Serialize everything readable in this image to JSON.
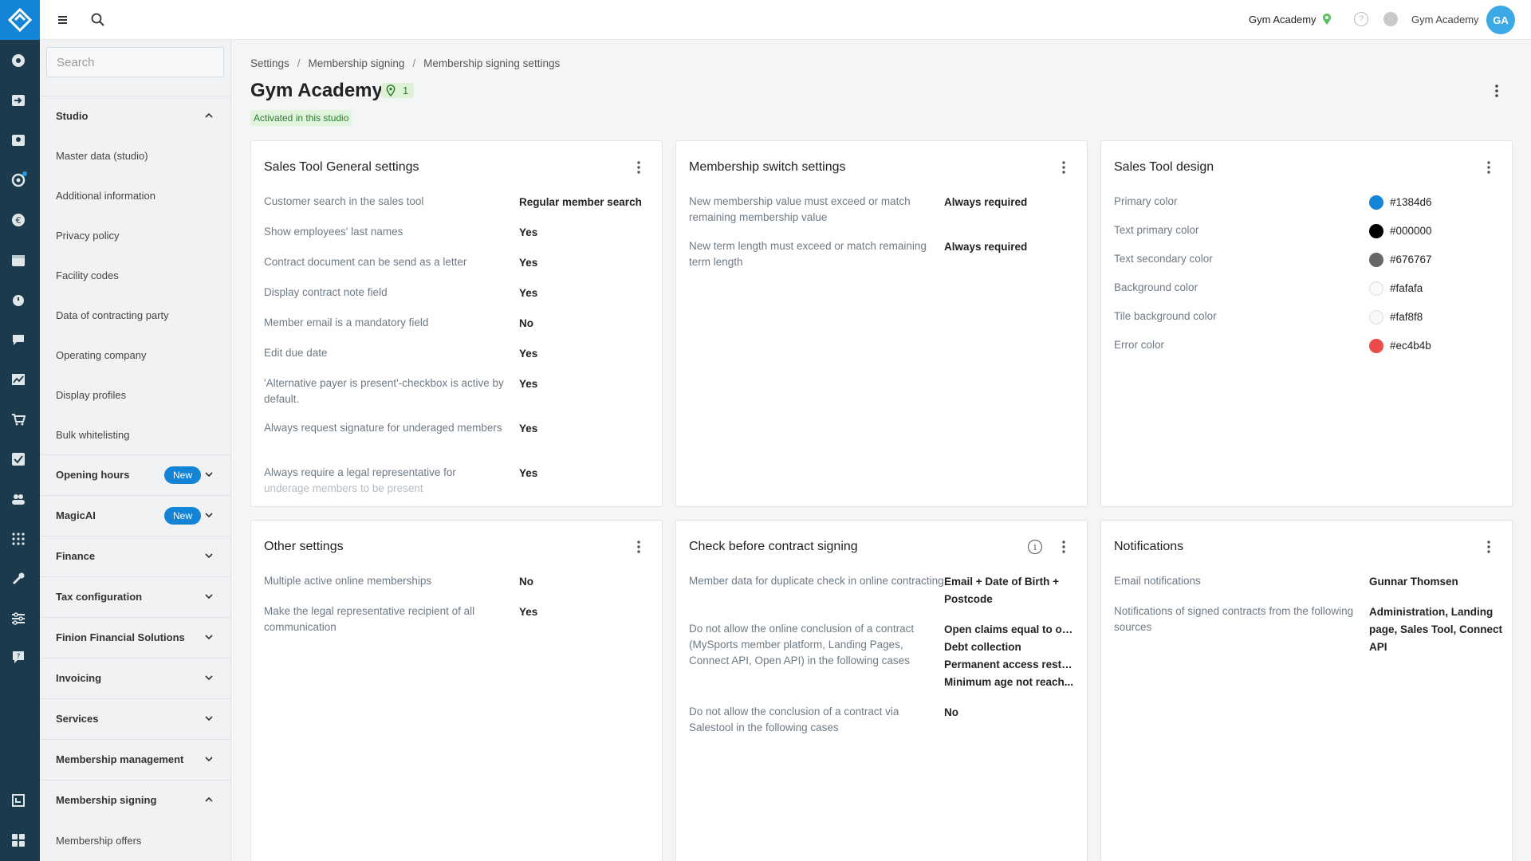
{
  "topbar": {
    "studio_name": "Gym Academy",
    "user_name": "Gym Academy",
    "avatar_initials": "GA",
    "help_glyph": "?"
  },
  "sidebar": {
    "search_placeholder": "Search",
    "sections": [
      {
        "label": "Studio",
        "expanded": true
      },
      {
        "label": "Opening hours",
        "badge": "New",
        "expanded": false
      },
      {
        "label": "MagicAI",
        "badge": "New",
        "expanded": false
      },
      {
        "label": "Finance",
        "expanded": false
      },
      {
        "label": "Tax configuration",
        "expanded": false
      },
      {
        "label": "Finion Financial Solutions",
        "expanded": false
      },
      {
        "label": "Invoicing",
        "expanded": false
      },
      {
        "label": "Services",
        "expanded": false
      },
      {
        "label": "Membership management",
        "expanded": false
      },
      {
        "label": "Membership signing",
        "expanded": true
      }
    ],
    "studio_items": [
      "Master data (studio)",
      "Additional information",
      "Privacy policy",
      "Facility codes",
      "Data of contracting party",
      "Operating company",
      "Display profiles",
      "Bulk whitelisting"
    ],
    "signing_items": [
      "Membership offers"
    ]
  },
  "breadcrumb": [
    "Settings",
    "Membership signing",
    "Membership signing settings"
  ],
  "breadcrumb_sep": "/",
  "page": {
    "title": "Gym Academy",
    "location_count": "1",
    "activated_label": "Activated in this studio"
  },
  "cards": {
    "general": {
      "title": "Sales Tool General settings",
      "rows": [
        {
          "label": "Customer search in the sales tool",
          "value": "Regular member search"
        },
        {
          "label": "Show employees' last names",
          "value": "Yes"
        },
        {
          "label": "Contract document can be send as a letter",
          "value": "Yes"
        },
        {
          "label": "Display contract note field",
          "value": "Yes"
        },
        {
          "label": "Member email is a mandatory field",
          "value": "No"
        },
        {
          "label": "Edit due date",
          "value": "Yes"
        },
        {
          "label": "'Alternative payer is present'-checkbox is active by default.",
          "value": "Yes"
        },
        {
          "label": "Always request signature for underaged members",
          "value": "Yes"
        },
        {
          "label": "Always require a legal representative for",
          "label2": "underage members to be present",
          "value": "Yes"
        }
      ]
    },
    "switch": {
      "title": "Membership switch settings",
      "rows": [
        {
          "label": "New membership value must exceed or match remaining membership value",
          "value": "Always required"
        },
        {
          "label": "New term length must exceed or match remaining term length",
          "value": "Always required"
        }
      ]
    },
    "design": {
      "title": "Sales Tool design",
      "rows": [
        {
          "label": "Primary color",
          "value": "#1384d6"
        },
        {
          "label": "Text primary color",
          "value": "#000000"
        },
        {
          "label": "Text secondary color",
          "value": "#676767"
        },
        {
          "label": "Background color",
          "value": "#fafafa"
        },
        {
          "label": "Tile background color",
          "value": "#faf8f8"
        },
        {
          "label": "Error color",
          "value": "#ec4b4b"
        }
      ]
    },
    "other": {
      "title": "Other settings",
      "rows": [
        {
          "label": "Multiple active online memberships",
          "value": "No"
        },
        {
          "label": "Make the legal representative recipient of all communication",
          "value": "Yes"
        }
      ]
    },
    "check": {
      "title": "Check before contract signing",
      "info_glyph": "i",
      "rows": [
        {
          "label": "Member data for duplicate check in online contracting",
          "values": [
            "Email + Date of Birth +",
            "Postcode"
          ]
        },
        {
          "label": "Do not allow the online conclusion of a contract (MySports member platform, Landing Pages, Connect API, Open API) in the following cases",
          "values": [
            "Open claims equal to or ...",
            "Debt collection",
            "Permanent access restri...",
            "Minimum age not reach..."
          ]
        },
        {
          "label": "Do not allow the conclusion of a contract via Salestool in the following cases",
          "values": [
            "No"
          ]
        }
      ]
    },
    "notifications": {
      "title": "Notifications",
      "rows": [
        {
          "label": "Email notifications",
          "values": [
            "Gunnar Thomsen"
          ]
        },
        {
          "label": "Notifications of signed contracts from the following sources",
          "values": [
            "Administration, Landing",
            "page, Sales Tool, Connect",
            "API"
          ]
        }
      ]
    }
  }
}
